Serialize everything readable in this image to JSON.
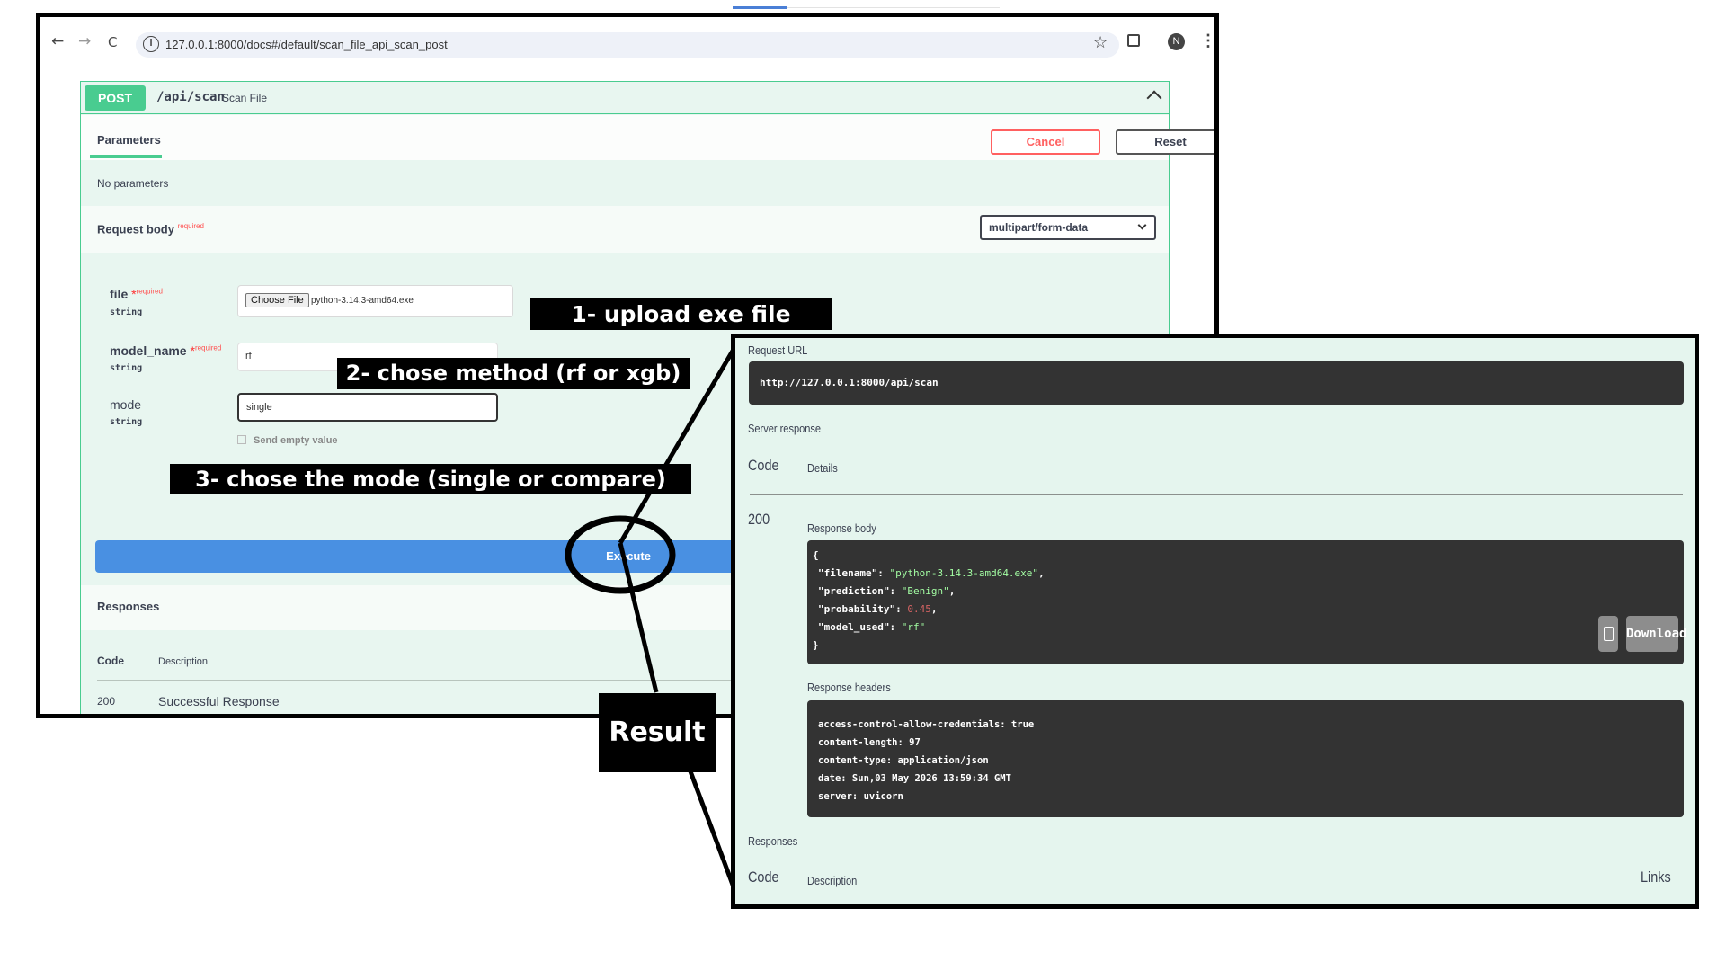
{
  "browser": {
    "url": "127.0.0.1:8000/docs#/default/scan_file_api_scan_post",
    "nav": {
      "back": "←",
      "forward": "→",
      "reload": "C"
    },
    "avatar_letter": "N"
  },
  "operation": {
    "method": "POST",
    "path": "/api/scan",
    "summary": "Scan File",
    "parameters_tab": "Parameters",
    "cancel_label": "Cancel",
    "reset_label": "Reset",
    "no_parameters": "No parameters",
    "request_body_label": "Request body",
    "required_label": "required",
    "content_type": "multipart/form-data",
    "fields": {
      "file": {
        "name": "file",
        "required_mark": "*",
        "required": "required",
        "type": "string",
        "choose_label": "Choose File",
        "file_name": "python-3.14.3-amd64.exe"
      },
      "model_name": {
        "name": "model_name",
        "required_mark": "*",
        "required": "required",
        "type": "string",
        "value": "rf"
      },
      "mode": {
        "name": "mode",
        "type": "string",
        "value": "single"
      }
    },
    "send_empty_value": "Send empty value",
    "execute_label": "Execute",
    "responses_title": "Responses",
    "responses_table": {
      "code_header": "Code",
      "description_header": "Description",
      "rows": [
        {
          "code": "200",
          "description": "Successful Response"
        }
      ]
    }
  },
  "callouts": {
    "step1": "1- upload exe file",
    "step2": "2- chose method (rf or xgb)",
    "step3": "3- chose the mode (single or compare)",
    "result": "Result"
  },
  "result": {
    "request_url_label": "Request URL",
    "request_url": "http://127.0.0.1:8000/api/scan",
    "server_response_label": "Server response",
    "code_header": "Code",
    "details_header": "Details",
    "status_code": "200",
    "response_body_label": "Response body",
    "response_body": {
      "open": "{",
      "filename_key": "\"filename\"",
      "filename_value": "\"python-3.14.3-amd64.exe\"",
      "prediction_key": "\"prediction\"",
      "prediction_value": "\"Benign\"",
      "probability_key": "\"probability\"",
      "probability_value": "0.45",
      "model_used_key": "\"model_used\"",
      "model_used_value": "\"rf\"",
      "close": "}"
    },
    "download_label": "Download",
    "response_headers_label": "Response headers",
    "response_headers": [
      "access-control-allow-credentials: true",
      "content-length: 97",
      "content-type: application/json",
      "date: Sun,03 May 2026 13:59:34 GMT",
      "server: uvicorn"
    ],
    "responses_label": "Responses",
    "responses_code_header": "Code",
    "responses_description_header": "Description",
    "responses_links_header": "Links"
  },
  "colors": {
    "post_green": "#49cc90",
    "execute_blue": "#4990e2",
    "cancel_red": "#ff6060",
    "code_bg": "#333333",
    "string_green": "#a2fca2",
    "number_red": "#d36363"
  }
}
